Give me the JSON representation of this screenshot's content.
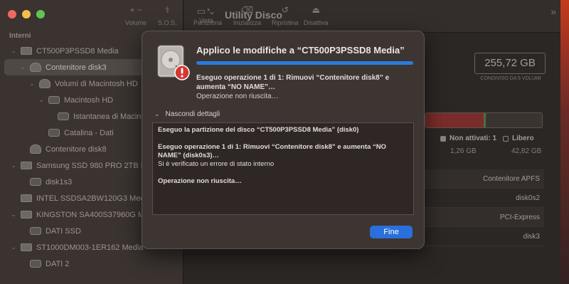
{
  "app": {
    "title": "Utility Disco"
  },
  "toolbar": {
    "view_label": "Vista",
    "buttons": [
      {
        "label": "Volume",
        "icon": "plus-minus-icon",
        "glyph": "+  −"
      },
      {
        "label": "S.O.S.",
        "icon": "stethoscope-icon",
        "glyph": "⚕"
      },
      {
        "label": "Partiziona",
        "icon": "pie-chart-icon",
        "glyph": "◔"
      },
      {
        "label": "Inizializza",
        "icon": "erase-disk-icon",
        "glyph": "⌫"
      },
      {
        "label": "Ripristina",
        "icon": "restore-icon",
        "glyph": "↺"
      },
      {
        "label": "Disattiva",
        "icon": "eject-icon",
        "glyph": "⏏"
      }
    ]
  },
  "sidebar": {
    "heading": "Interni",
    "items": [
      {
        "label": "CT500P3PSSD8 Media",
        "indent": 0,
        "chevron": "⌄",
        "icon": "internal-disk-icon"
      },
      {
        "label": "Contenitore disk3",
        "indent": 1,
        "chevron": "⌄",
        "icon": "container-icon",
        "selected": true
      },
      {
        "label": "Volumi di Macintosh HD",
        "indent": 2,
        "chevron": "⌄",
        "icon": "volume-group-icon"
      },
      {
        "label": "Macintosh HD",
        "indent": 3,
        "chevron": "⌄",
        "icon": "volume-icon"
      },
      {
        "label": "Istantanea di Macintosh HD",
        "indent": 4,
        "chevron": "",
        "icon": "snapshot-icon"
      },
      {
        "label": "Catalina - Dati",
        "indent": 3,
        "chevron": "",
        "icon": "volume-icon"
      },
      {
        "label": "Contenitore disk8",
        "indent": 1,
        "chevron": "",
        "icon": "container-icon"
      },
      {
        "label": "Samsung SSD 980 PRO 2TB Media",
        "indent": 0,
        "chevron": "⌄",
        "icon": "internal-disk-icon"
      },
      {
        "label": "disk1s3",
        "indent": 1,
        "chevron": "",
        "icon": "volume-icon"
      },
      {
        "label": "INTEL SSDSA2BW120G3 Media",
        "indent": 0,
        "chevron": "",
        "icon": "internal-disk-icon"
      },
      {
        "label": "KINGSTON SA400S37960G Media",
        "indent": 0,
        "chevron": "⌄",
        "icon": "internal-disk-icon"
      },
      {
        "label": "DATI SSD",
        "indent": 1,
        "chevron": "",
        "icon": "volume-icon"
      },
      {
        "label": "ST1000DM003-1ER162 Media",
        "indent": 0,
        "chevron": "⌄",
        "icon": "internal-disk-icon"
      },
      {
        "label": "DATI 2",
        "indent": 1,
        "chevron": "",
        "icon": "volume-icon"
      }
    ]
  },
  "main": {
    "capacity": "255,72 GB",
    "capacity_caption": "CONDIVISO DA 5 VOLUMI",
    "usage": {
      "used_fraction": 0.5,
      "inactive_label": "Non attivati: 1",
      "inactive_value": "1,26 GB",
      "free_label": "Libero",
      "free_value": "42,82 GB",
      "used_color": "#7a2c2a",
      "inactive_color": "#4a6e3a"
    },
    "info_rows": [
      "Contenitore APFS",
      "disk0s2",
      "PCI-Express",
      "disk3"
    ]
  },
  "dialog": {
    "title": "Applico le modifiche a “CT500P3PSSD8 Media”",
    "progress": 1.0,
    "operation": "Eseguo operazione 1 di 1: Rimuovi “Contenitore disk8” e aumenta “NO NAME”…",
    "status": "Operazione non riuscita…",
    "details_toggle": "Nascondi dettagli",
    "details": [
      {
        "text": "Eseguo la partizione del disco “CT500P3PSSD8 Media” (disk0)",
        "bold": true
      },
      {
        "text": "Eseguo operazione 1 di 1: Rimuovi “Contenitore disk8” e aumenta “NO NAME” (disk0s3)…",
        "bold": true,
        "gap": true
      },
      {
        "text": "Si è verificato un errore di stato interno",
        "bold": false
      },
      {
        "text": "Operazione non riuscita…",
        "bold": true,
        "gap": true
      }
    ],
    "button_label": "Fine",
    "accent_color": "#2a6fdb"
  }
}
